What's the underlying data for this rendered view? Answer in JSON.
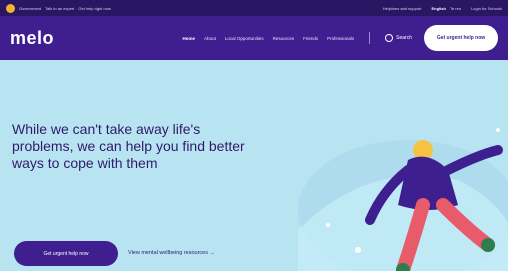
{
  "top_bar": {
    "left_text_1": "Government",
    "left_text_2": "Talk to an expert",
    "left_text_3": "Get help right now",
    "right_text_1": "Helplines and support",
    "lang_active": "English",
    "lang_other": "Te reo",
    "login": "Login for Schools"
  },
  "nav": {
    "logo": "melo",
    "links": [
      "Home",
      "About",
      "Local Opportunities",
      "Resources",
      "Friends",
      "Professionals"
    ],
    "search_label": "Search",
    "cta_label": "Get urgent help now"
  },
  "hero": {
    "heading": "While we can't take away life's problems, we can help you find better ways to cope with them",
    "primary_button": "Get urgent help now",
    "secondary_link": "View mental wellbeing resources →"
  }
}
